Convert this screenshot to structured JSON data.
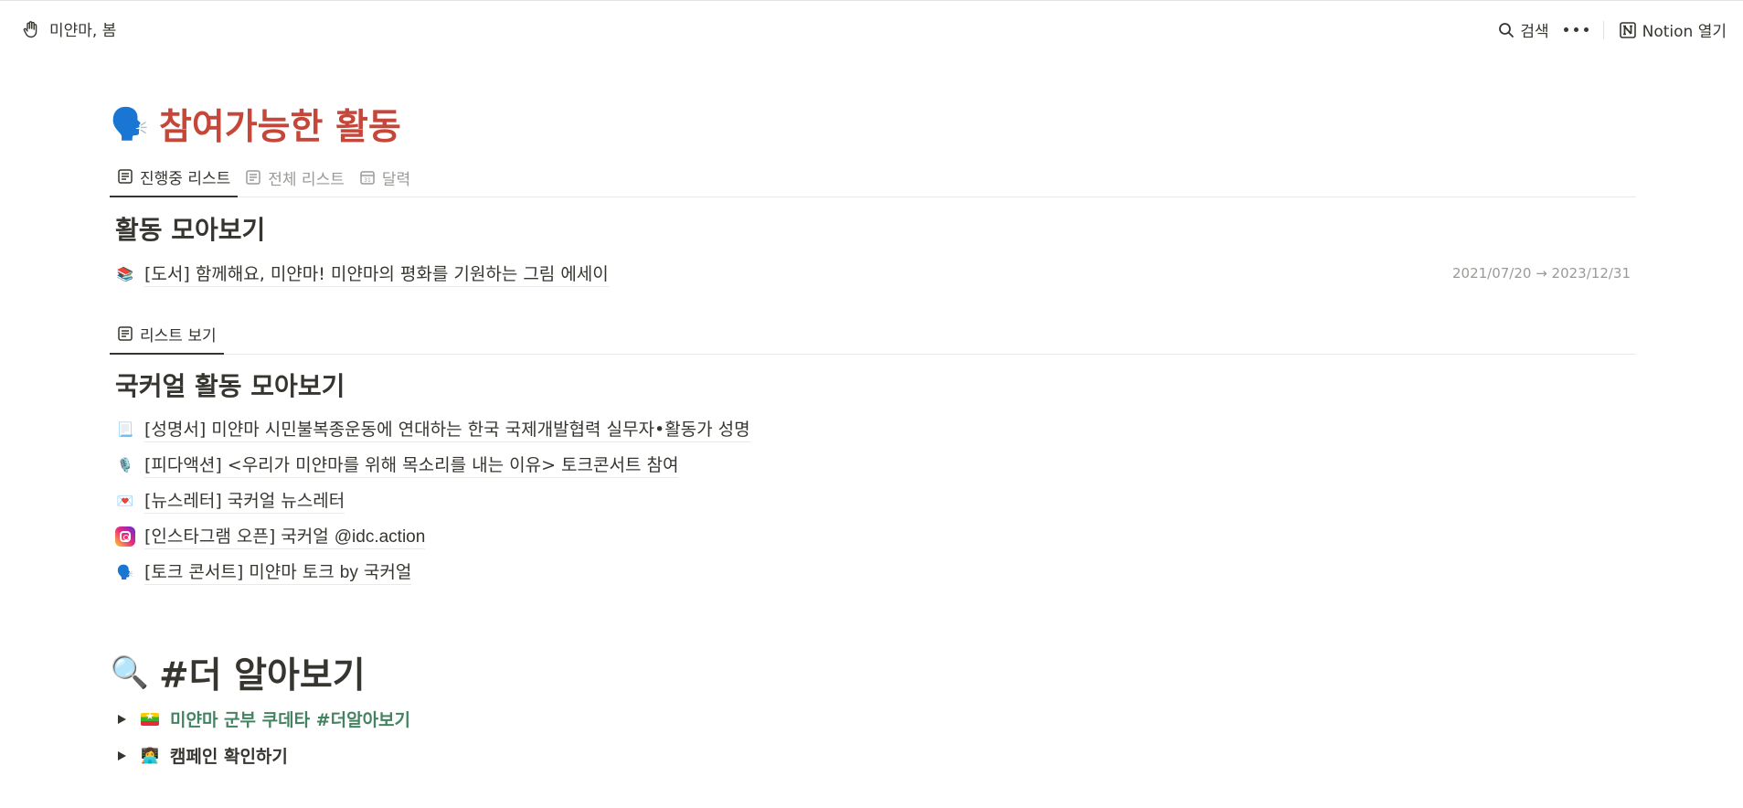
{
  "topbar": {
    "breadcrumb": "미얀마, 봄",
    "search_label": "검색",
    "open_label": "Notion 열기"
  },
  "section1": {
    "title": "참여가능한 활동",
    "tabs": [
      {
        "label": "진행중 리스트",
        "icon": "list-icon",
        "active": true
      },
      {
        "label": "전체 리스트",
        "icon": "list-icon",
        "active": false
      },
      {
        "label": "달력",
        "icon": "calendar-icon",
        "active": false
      }
    ],
    "gallery_title": "활동 모아보기",
    "items": [
      {
        "emoji": "📚",
        "text": "[도서] 함께해요, 미얀마! 미얀마의 평화를 기원하는 그림 에세이",
        "date": "2021/07/20 → 2023/12/31"
      }
    ]
  },
  "section2": {
    "tabs": [
      {
        "label": "리스트 보기",
        "icon": "list-icon",
        "active": true
      }
    ],
    "gallery_title": "국커얼 활동 모아보기",
    "items": [
      {
        "emoji": "📃",
        "text": "[성명서] 미얀마 시민불복종운동에 연대하는 한국 국제개발협력 실무자•활동가 성명"
      },
      {
        "emoji": "🎙️",
        "text": "[피다액션] <우리가 미얀마를 위해 목소리를 내는 이유> 토크콘서트 참여"
      },
      {
        "emoji": "💌",
        "text": "[뉴스레터] 국커얼 뉴스레터"
      },
      {
        "emoji": "instagram",
        "text_ko": "[인스타그램 오픈] 국커얼 ",
        "text_en": "@idc.action"
      },
      {
        "emoji": "🗣️",
        "text_a": "[토크 콘서트] 미얀마 토크 ",
        "text_en": "by",
        "text_b": " 국커얼"
      }
    ]
  },
  "section3": {
    "title": "#더 알아보기",
    "toggles": [
      {
        "label": "미얀마 군부 쿠데타 #더알아보기",
        "color": "#448361"
      },
      {
        "label": "캠페인 확인하기",
        "color": "#37352f"
      }
    ]
  },
  "colors": {
    "title_red": "#c4473a",
    "text": "#37352f",
    "muted": "#9b9a97",
    "green": "#448361"
  }
}
